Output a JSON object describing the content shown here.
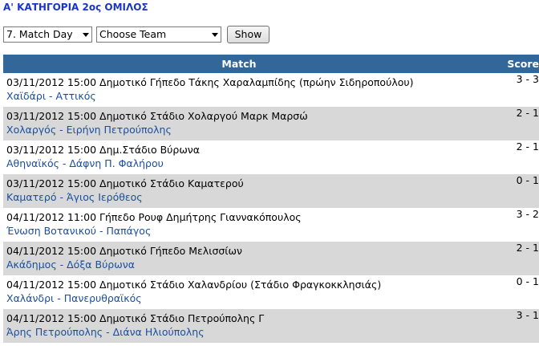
{
  "page_title": "Α' ΚΑΤΗΓΟΡΙΑ 2ος ΟΜΙΛΟΣ",
  "filters": {
    "match_day": "7. Match Day",
    "team": "Choose Team",
    "show_label": "Show"
  },
  "table": {
    "headers": {
      "match": "Match",
      "score": "Score"
    },
    "rows": [
      {
        "info": "03/11/2012 15:00 Δημοτικό Γήπεδο Τάκης Χαραλαμπίδης (πρώην Σιδηροπούλου)",
        "teams": "Χαϊδάρι - Αττικός",
        "score": "3 - 3"
      },
      {
        "info": "03/11/2012 15:00 Δημοτικό Στάδιο Χολαργού Μαρκ Μαρσώ",
        "teams": "Χολαργός - Ειρήνη Πετρούπολης",
        "score": "2 - 1"
      },
      {
        "info": "03/11/2012 15:00 Δημ.Στάδιο Βύρωνα",
        "teams": "Αθηναϊκός - Δάφνη Π. Φαλήρου",
        "score": "2 - 1"
      },
      {
        "info": "03/11/2012 15:00 Δημοτικό Στάδιο Καματερού",
        "teams": "Καματερό - Άγιος Ιερόθεος",
        "score": "0 - 1"
      },
      {
        "info": "04/11/2012 11:00 Γήπεδο Ρουφ Δημήτρης Γιαννακόπουλος",
        "teams": "Ένωση Βοτανικού - Παπάγος",
        "score": "3 - 2"
      },
      {
        "info": "04/11/2012 15:00 Δημοτικό Γήπεδο Μελισσίων",
        "teams": "Ακάδημος - Δόξα Βύρωνα",
        "score": "2 - 1"
      },
      {
        "info": "04/11/2012 15:00 Δημοτικό Στάδιο Χαλανδρίου (Στάδιο Φραγκοκκλησιάς)",
        "teams": "Χαλάνδρι - Πανερυθραϊκός",
        "score": "0 - 1"
      },
      {
        "info": "04/11/2012 15:00 Δημοτικό Στάδιο Πετρούπολης Γ",
        "teams": "Άρης Πετρούπολης - Διάνα Ηλιούπολης",
        "score": "3 - 1"
      }
    ]
  },
  "colors": {
    "title": "#1a35c8",
    "header_bg": "#336699",
    "link": "#1a4fa0",
    "row_alt": "#d8d8d8"
  }
}
